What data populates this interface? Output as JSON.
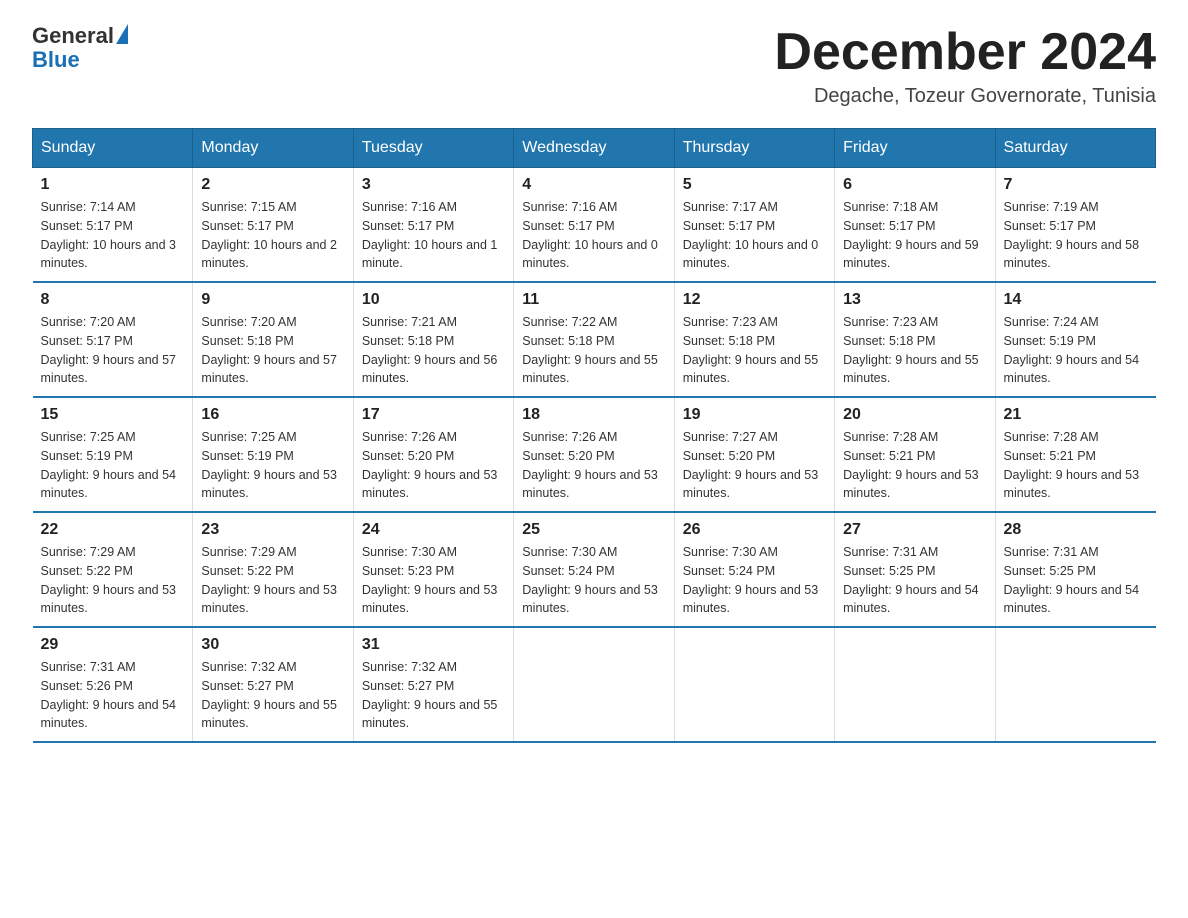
{
  "logo": {
    "text_general": "General",
    "text_blue": "Blue"
  },
  "title": "December 2024",
  "location": "Degache, Tozeur Governorate, Tunisia",
  "days_of_week": [
    "Sunday",
    "Monday",
    "Tuesday",
    "Wednesday",
    "Thursday",
    "Friday",
    "Saturday"
  ],
  "weeks": [
    [
      {
        "day": "1",
        "sunrise": "7:14 AM",
        "sunset": "5:17 PM",
        "daylight": "10 hours and 3 minutes."
      },
      {
        "day": "2",
        "sunrise": "7:15 AM",
        "sunset": "5:17 PM",
        "daylight": "10 hours and 2 minutes."
      },
      {
        "day": "3",
        "sunrise": "7:16 AM",
        "sunset": "5:17 PM",
        "daylight": "10 hours and 1 minute."
      },
      {
        "day": "4",
        "sunrise": "7:16 AM",
        "sunset": "5:17 PM",
        "daylight": "10 hours and 0 minutes."
      },
      {
        "day": "5",
        "sunrise": "7:17 AM",
        "sunset": "5:17 PM",
        "daylight": "10 hours and 0 minutes."
      },
      {
        "day": "6",
        "sunrise": "7:18 AM",
        "sunset": "5:17 PM",
        "daylight": "9 hours and 59 minutes."
      },
      {
        "day": "7",
        "sunrise": "7:19 AM",
        "sunset": "5:17 PM",
        "daylight": "9 hours and 58 minutes."
      }
    ],
    [
      {
        "day": "8",
        "sunrise": "7:20 AM",
        "sunset": "5:17 PM",
        "daylight": "9 hours and 57 minutes."
      },
      {
        "day": "9",
        "sunrise": "7:20 AM",
        "sunset": "5:18 PM",
        "daylight": "9 hours and 57 minutes."
      },
      {
        "day": "10",
        "sunrise": "7:21 AM",
        "sunset": "5:18 PM",
        "daylight": "9 hours and 56 minutes."
      },
      {
        "day": "11",
        "sunrise": "7:22 AM",
        "sunset": "5:18 PM",
        "daylight": "9 hours and 55 minutes."
      },
      {
        "day": "12",
        "sunrise": "7:23 AM",
        "sunset": "5:18 PM",
        "daylight": "9 hours and 55 minutes."
      },
      {
        "day": "13",
        "sunrise": "7:23 AM",
        "sunset": "5:18 PM",
        "daylight": "9 hours and 55 minutes."
      },
      {
        "day": "14",
        "sunrise": "7:24 AM",
        "sunset": "5:19 PM",
        "daylight": "9 hours and 54 minutes."
      }
    ],
    [
      {
        "day": "15",
        "sunrise": "7:25 AM",
        "sunset": "5:19 PM",
        "daylight": "9 hours and 54 minutes."
      },
      {
        "day": "16",
        "sunrise": "7:25 AM",
        "sunset": "5:19 PM",
        "daylight": "9 hours and 53 minutes."
      },
      {
        "day": "17",
        "sunrise": "7:26 AM",
        "sunset": "5:20 PM",
        "daylight": "9 hours and 53 minutes."
      },
      {
        "day": "18",
        "sunrise": "7:26 AM",
        "sunset": "5:20 PM",
        "daylight": "9 hours and 53 minutes."
      },
      {
        "day": "19",
        "sunrise": "7:27 AM",
        "sunset": "5:20 PM",
        "daylight": "9 hours and 53 minutes."
      },
      {
        "day": "20",
        "sunrise": "7:28 AM",
        "sunset": "5:21 PM",
        "daylight": "9 hours and 53 minutes."
      },
      {
        "day": "21",
        "sunrise": "7:28 AM",
        "sunset": "5:21 PM",
        "daylight": "9 hours and 53 minutes."
      }
    ],
    [
      {
        "day": "22",
        "sunrise": "7:29 AM",
        "sunset": "5:22 PM",
        "daylight": "9 hours and 53 minutes."
      },
      {
        "day": "23",
        "sunrise": "7:29 AM",
        "sunset": "5:22 PM",
        "daylight": "9 hours and 53 minutes."
      },
      {
        "day": "24",
        "sunrise": "7:30 AM",
        "sunset": "5:23 PM",
        "daylight": "9 hours and 53 minutes."
      },
      {
        "day": "25",
        "sunrise": "7:30 AM",
        "sunset": "5:24 PM",
        "daylight": "9 hours and 53 minutes."
      },
      {
        "day": "26",
        "sunrise": "7:30 AM",
        "sunset": "5:24 PM",
        "daylight": "9 hours and 53 minutes."
      },
      {
        "day": "27",
        "sunrise": "7:31 AM",
        "sunset": "5:25 PM",
        "daylight": "9 hours and 54 minutes."
      },
      {
        "day": "28",
        "sunrise": "7:31 AM",
        "sunset": "5:25 PM",
        "daylight": "9 hours and 54 minutes."
      }
    ],
    [
      {
        "day": "29",
        "sunrise": "7:31 AM",
        "sunset": "5:26 PM",
        "daylight": "9 hours and 54 minutes."
      },
      {
        "day": "30",
        "sunrise": "7:32 AM",
        "sunset": "5:27 PM",
        "daylight": "9 hours and 55 minutes."
      },
      {
        "day": "31",
        "sunrise": "7:32 AM",
        "sunset": "5:27 PM",
        "daylight": "9 hours and 55 minutes."
      },
      null,
      null,
      null,
      null
    ]
  ]
}
